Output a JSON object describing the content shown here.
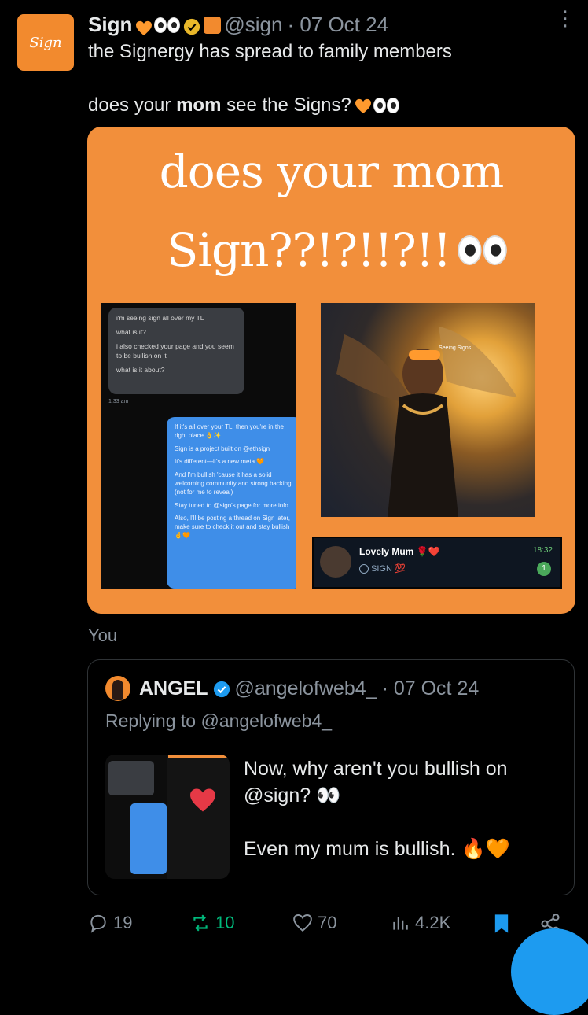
{
  "post": {
    "display_name": "Sign",
    "handle": "@sign",
    "date": "· 07 Oct 24",
    "avatar_text": "Sign",
    "line1": "the Signergy has spread to family members",
    "line2_before": "does your ",
    "line2_bold": "mom",
    "line2_after": " see the Signs?",
    "more_label": "⋮"
  },
  "card": {
    "title_line1": "does your mom",
    "title_line2": "Sign??!?!!?!!",
    "chat": {
      "grey_lines": [
        "i'm seeing sign all over my TL",
        "what is it?",
        "i also checked your page and you seem to be bullish on it",
        "what is it about?"
      ],
      "time": "1:33 am",
      "blue_lines": [
        "If it's all over your TL, then you're in the right place 👌✨",
        "Sign is a project built on @ethsign",
        "It's different—it's a new meta 🧡",
        "And I'm bullish 'cause it has a solid welcoming community and strong backing (not for me to reveal)",
        "Stay tuned to @sign's page for more info",
        "Also, I'll be posting a thread on Sign later, make sure to check it out and stay bullish 🤞🧡"
      ]
    },
    "art_label": "Seeing Signs",
    "telegram": {
      "name": "Lovely Mum 🌹❤️",
      "sub": "SIGN 💯",
      "time": "18:32",
      "unread": "1"
    }
  },
  "you_label": "You",
  "quote": {
    "display_name": "ANGEL",
    "handle": "@angelofweb4_",
    "date": "· 07 Oct 24",
    "replying": "Replying to @angelofweb4_",
    "text_line1": "Now, why aren't you bullish on",
    "text_line2": "@sign? 👀",
    "text_line3": "Even my mum is bullish. 🔥🧡"
  },
  "actions": {
    "replies": "19",
    "reposts": "10",
    "likes": "70",
    "views": "4.2K"
  },
  "colors": {
    "accent_orange": "#f28f3b",
    "verified_blue": "#1d9bf0",
    "repost_green": "#00ba7c",
    "muted": "#8b949e"
  }
}
